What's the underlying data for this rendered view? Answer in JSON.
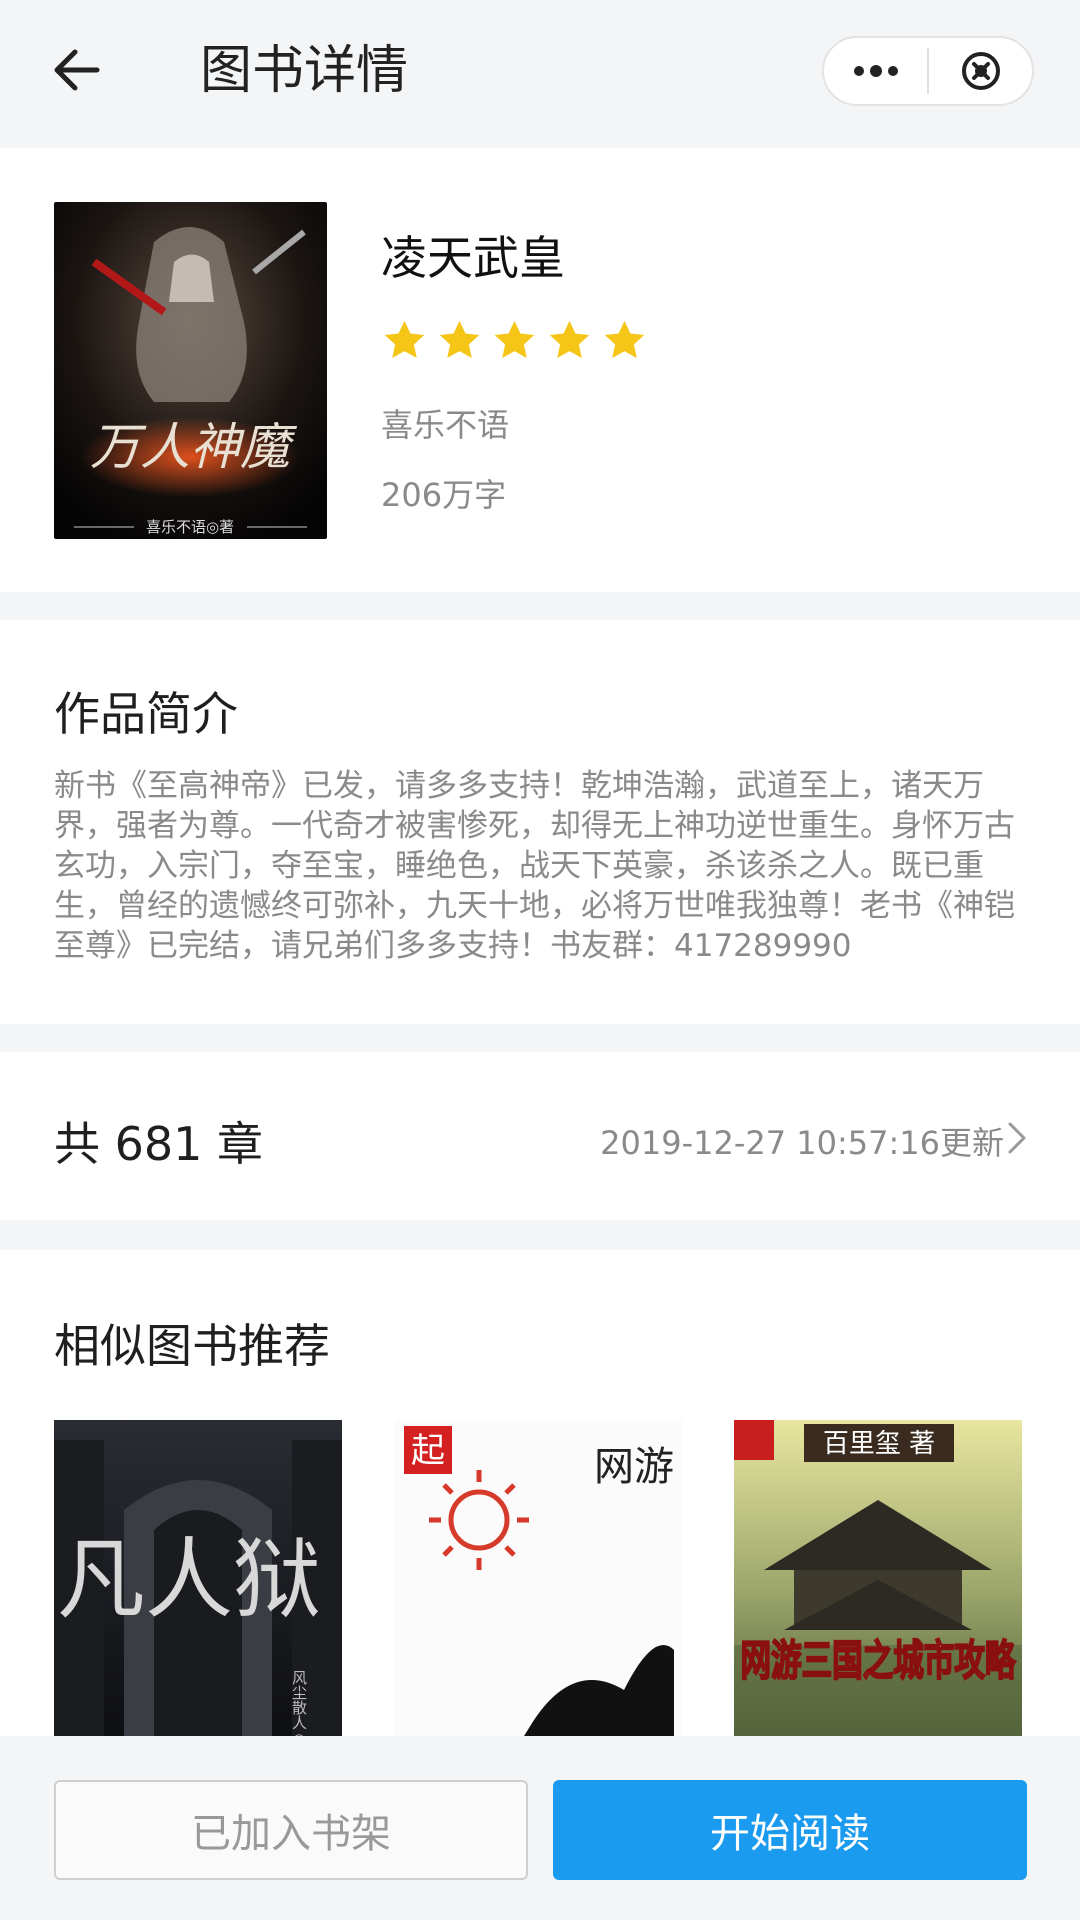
{
  "header": {
    "title": "图书详情"
  },
  "book": {
    "title": "凌天武皇",
    "rating": 5,
    "author": "喜乐不语",
    "words": "206万字",
    "cover_title": "万人神魔",
    "cover_author": "喜乐不语◎著"
  },
  "intro": {
    "heading": "作品简介",
    "text": "新书《至高神帝》已发，请多多支持！乾坤浩瀚，武道至上，诸天万界，强者为尊。一代奇才被害惨死，却得无上神功逆世重生。身怀万古玄功，入宗门，夺至宝，睡绝色，战天下英豪，杀该杀之人。既已重生，曾经的遗憾终可弥补，九天十地，必将万世唯我独尊！老书《神铠至尊》已完结，请兄弟们多多支持！书友群：417289990"
  },
  "chapters": {
    "count_label": "共 681 章",
    "update_label": "2019-12-27 10:57:16更新"
  },
  "similar": {
    "heading": "相似图书推荐",
    "books": [
      {
        "cover_text": "凡人狱",
        "cover_sub": "风尘散人◎著"
      },
      {
        "cover_text": "网游 射线 九天人来",
        "cover_sub": "起"
      },
      {
        "cover_text": "网游三国之城市攻略",
        "cover_sub": "百里玺 著"
      }
    ]
  },
  "actions": {
    "shelf_label": "已加入书架",
    "read_label": "开始阅读"
  },
  "colors": {
    "accent": "#1a9bf0",
    "star": "#f5c518",
    "muted": "#8a8a8a"
  }
}
